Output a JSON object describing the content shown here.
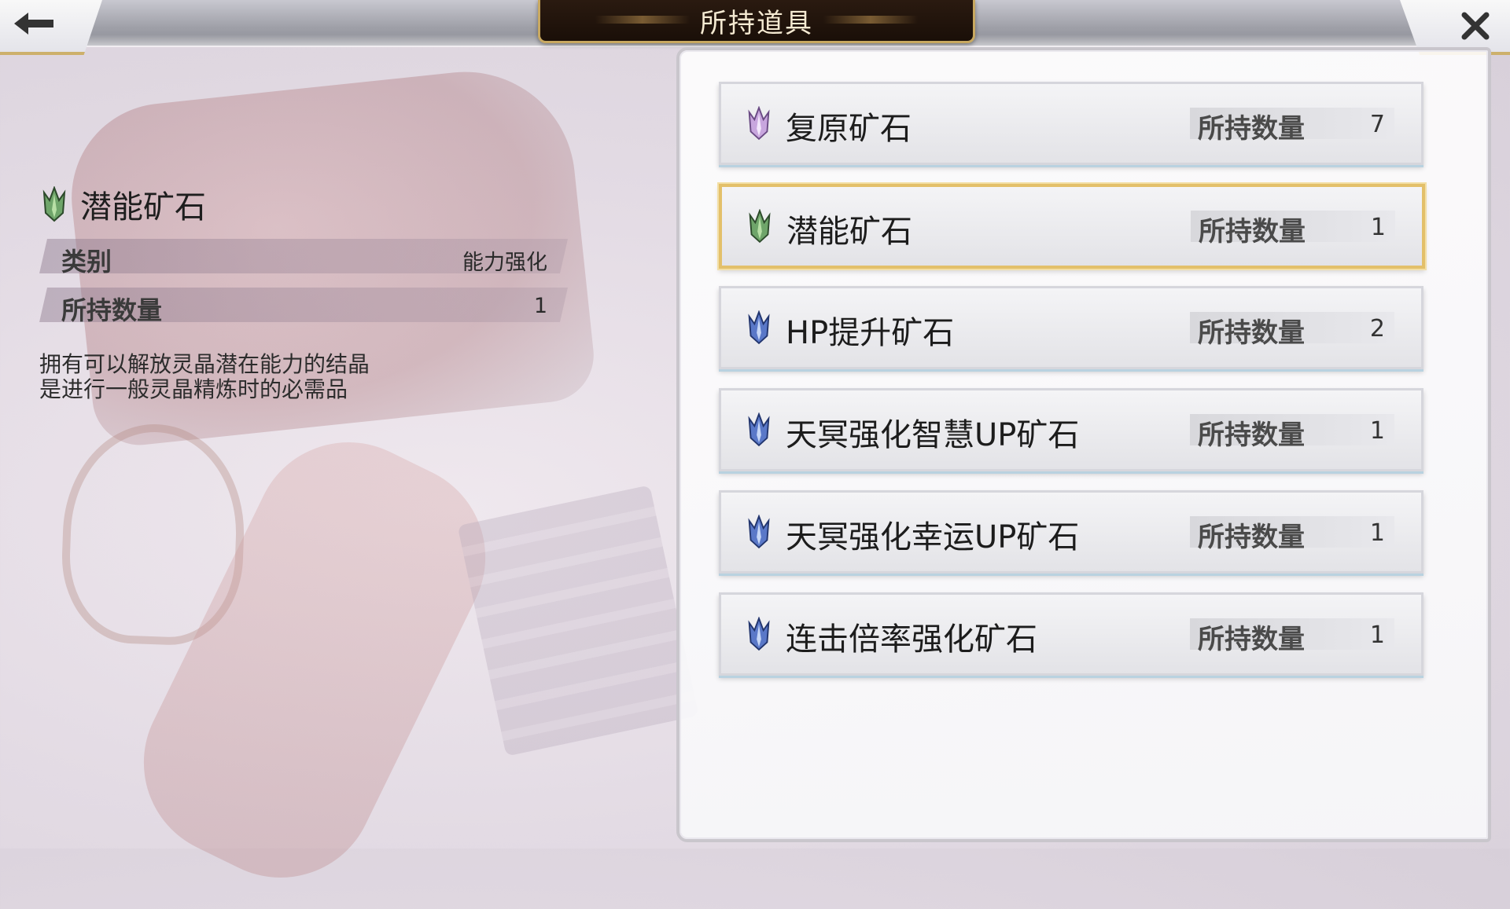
{
  "header": {
    "title": "所持道具",
    "back_icon": "back-arrow-icon",
    "close_icon": "close-icon"
  },
  "detail": {
    "item_name": "潜能矿石",
    "icon": "green-crystal-icon",
    "rows": [
      {
        "label": "类别",
        "value": "能力强化"
      },
      {
        "label": "所持数量",
        "value": "1"
      }
    ],
    "description_lines": [
      "拥有可以解放灵晶潜在能力的结晶",
      "是进行一般灵晶精炼时的必需品"
    ]
  },
  "items": [
    {
      "name": "复原矿石",
      "qty_label": "所持数量",
      "qty": "7",
      "icon": "purple-crystal-icon",
      "selected": false
    },
    {
      "name": "潜能矿石",
      "qty_label": "所持数量",
      "qty": "1",
      "icon": "green-crystal-icon",
      "selected": true
    },
    {
      "name": "HP提升矿石",
      "qty_label": "所持数量",
      "qty": "2",
      "icon": "blue-crystal-icon",
      "selected": false
    },
    {
      "name": "天冥强化智慧UP矿石",
      "qty_label": "所持数量",
      "qty": "1",
      "icon": "blue-crystal-icon",
      "selected": false
    },
    {
      "name": "天冥强化幸运UP矿石",
      "qty_label": "所持数量",
      "qty": "1",
      "icon": "blue-crystal-icon",
      "selected": false
    },
    {
      "name": "连击倍率强化矿石",
      "qty_label": "所持数量",
      "qty": "1",
      "icon": "blue-crystal-icon",
      "selected": false
    }
  ],
  "colors": {
    "selected_border": "#e3c06a",
    "title_plate": "#1a0f08",
    "title_text": "#f5ead2"
  }
}
